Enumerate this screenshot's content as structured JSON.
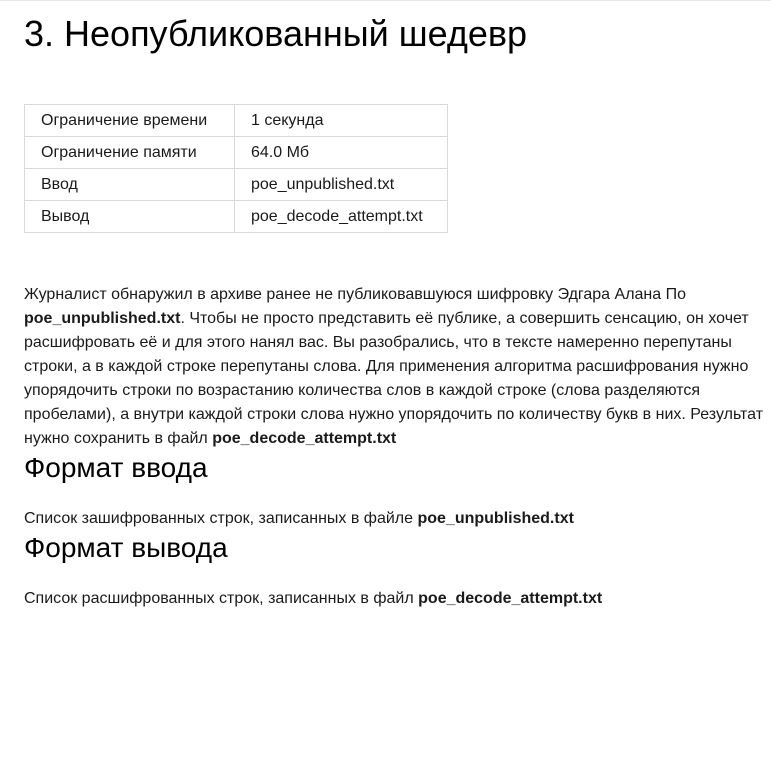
{
  "problem": {
    "title": "3. Неопубликованный шедевр",
    "limits": [
      {
        "key": "Ограничение времени",
        "value": "1 секунда"
      },
      {
        "key": "Ограничение памяти",
        "value": "64.0 Мб"
      },
      {
        "key": "Ввод",
        "value": "poe_unpublished.txt"
      },
      {
        "key": "Вывод",
        "value": "poe_decode_attempt.txt"
      }
    ],
    "statement": {
      "part1": "Журналист обнаружил в архиве ранее не публиковавшуюся шифровку Эдгара Алана По ",
      "file_in": "poe_unpublished.txt",
      "part2": ". Чтобы не просто представить её публике, а совершить сенсацию, он хочет расшифровать её и для этого нанял вас. Вы разобрались, что в тексте намеренно перепутаны строки, а в каждой строке перепутаны слова. Для применения алгоритма расшифрования нужно упорядочить строки по возрастанию количества слов в каждой строке (слова разделяются пробелами), а внутри каждой строки слова нужно упорядочить по количеству букв в них. Результат нужно сохранить в файл ",
      "file_out": "poe_decode_attempt.txt"
    },
    "input_format": {
      "title": "Формат ввода",
      "text": "Список зашифрованных строк, записанных в файле ",
      "file": "poe_unpublished.txt"
    },
    "output_format": {
      "title": "Формат вывода",
      "text": "Список расшифрованных строк, записанных в файл ",
      "file": "poe_decode_attempt.txt"
    }
  }
}
